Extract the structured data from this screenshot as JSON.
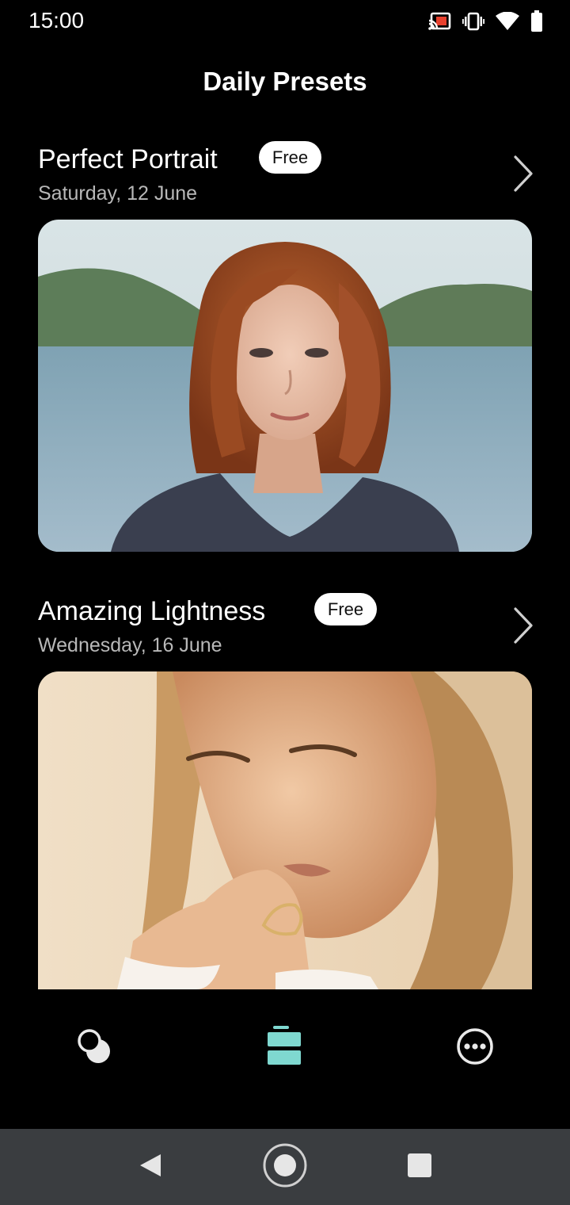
{
  "status_bar": {
    "time": "15:00",
    "icons": [
      "cast-icon",
      "vibrate-icon",
      "wifi-icon",
      "battery-icon"
    ]
  },
  "header": {
    "title": "Daily Presets"
  },
  "presets": [
    {
      "title": "Perfect Portrait",
      "badge": "Free",
      "date": "Saturday, 12 June",
      "image": "portrait-photo"
    },
    {
      "title": "Amazing Lightness",
      "badge": "Free",
      "date": "Wednesday, 16 June",
      "image": "lightness-photo"
    }
  ],
  "bottom_nav": {
    "items": [
      {
        "icon": "presets-icon",
        "active": false
      },
      {
        "icon": "daily-icon",
        "active": true
      },
      {
        "icon": "more-icon",
        "active": false
      }
    ],
    "accent": "#7fd8d0"
  },
  "system_nav": {
    "buttons": [
      "back-icon",
      "home-icon",
      "recents-icon"
    ]
  }
}
